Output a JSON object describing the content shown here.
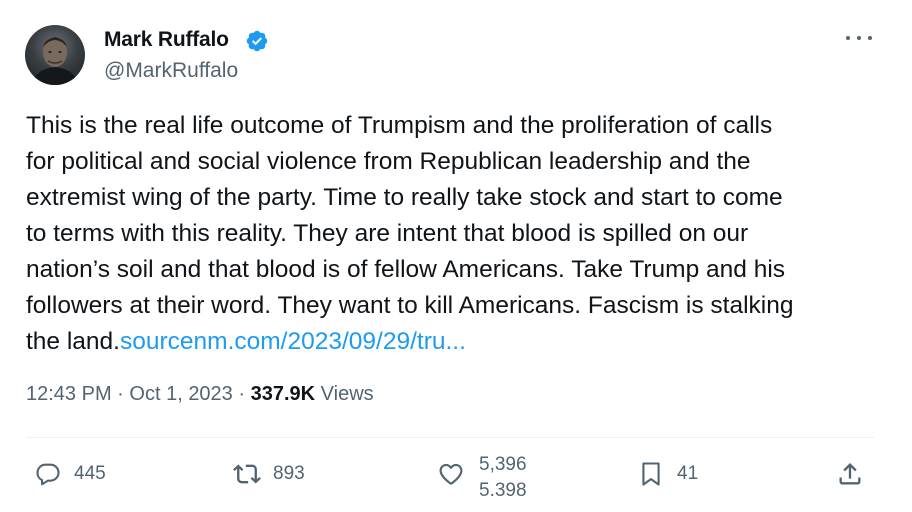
{
  "author": {
    "display_name": "Mark Ruffalo",
    "handle": "@MarkRuffalo",
    "verified": true
  },
  "tweet": {
    "lines": [
      "This is the real life outcome of Trumpism and the proliferation of  calls",
      "for political and social violence from Republican leadership and the",
      "extremist wing of the party. Time to really take stock and start to come",
      "to terms with this reality. They are intent that blood is spilled on our",
      "nation’s soil and that blood is of fellow Americans. Take Trump and his",
      "followers at their word. They want to kill Americans. Fascism is stalking"
    ],
    "last_line_text": "the land.",
    "link_text": "sourcenm.com/2023/09/29/tru..."
  },
  "meta": {
    "time": "12:43 PM",
    "separator": "·",
    "date": "Oct 1, 2023",
    "views_count": "337.9K",
    "views_label": "Views"
  },
  "actions": {
    "replies": "445",
    "reposts": "893",
    "likes": "5,396",
    "likes_next": "5,398",
    "bookmarks": "41"
  },
  "colors": {
    "text": "#0f1419",
    "secondary": "#536471",
    "link": "#1d9bf0",
    "verified": "#1d9bf0"
  }
}
